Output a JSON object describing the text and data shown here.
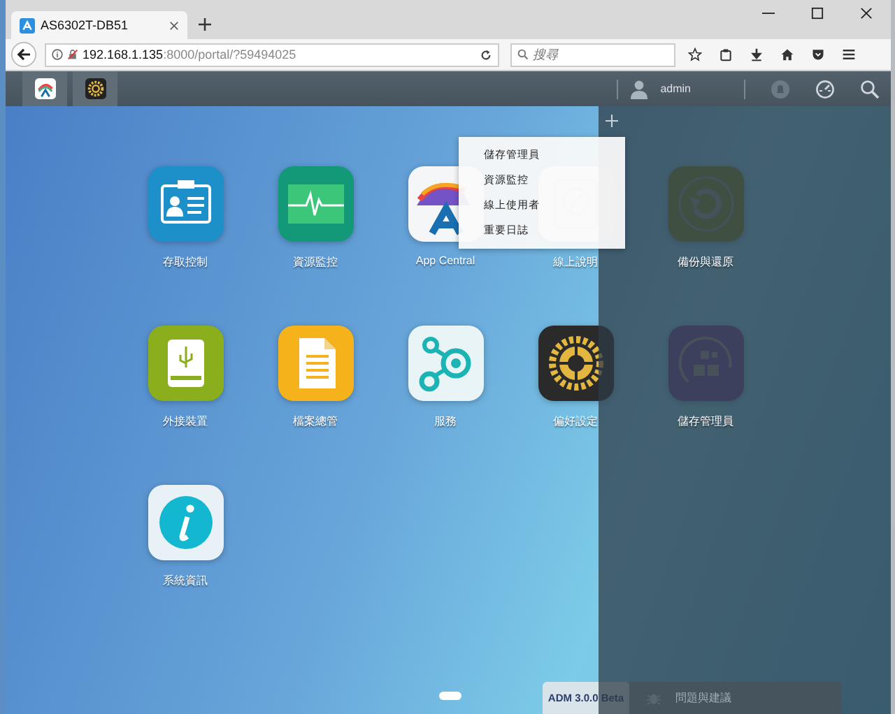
{
  "browser": {
    "tab_title": "AS6302T-DB51",
    "url_host": "192.168.1.135",
    "url_rest": ":8000/portal/?59494025",
    "search_placeholder": "搜尋"
  },
  "taskbar": {
    "user": "admin"
  },
  "apps": [
    {
      "label": "存取控制",
      "kind": "access"
    },
    {
      "label": "資源監控",
      "kind": "monitor"
    },
    {
      "label": "App Central",
      "kind": "appcentral"
    },
    {
      "label": "線上說明",
      "kind": "help"
    },
    {
      "label": "備份與還原",
      "kind": "backup"
    },
    {
      "label": "外接裝置",
      "kind": "external"
    },
    {
      "label": "檔案總管",
      "kind": "files"
    },
    {
      "label": "服務",
      "kind": "services"
    },
    {
      "label": "偏好設定",
      "kind": "settings"
    },
    {
      "label": "儲存管理員",
      "kind": "storage"
    },
    {
      "label": "系統資訊",
      "kind": "sysinfo"
    }
  ],
  "menu": {
    "items": [
      "儲存管理員",
      "資源監控",
      "線上使用者",
      "重要日誌"
    ]
  },
  "footer": {
    "version": "ADM 3.0.0 Beta",
    "feedback": "問題與建議"
  }
}
